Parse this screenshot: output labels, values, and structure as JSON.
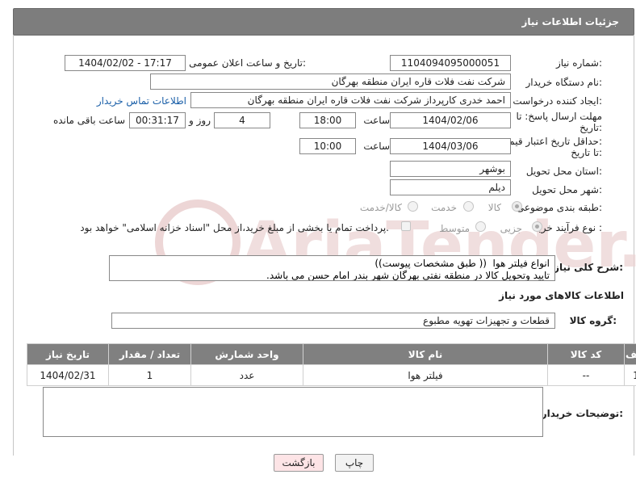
{
  "header": {
    "title": "جزئیات اطلاعات نیاز"
  },
  "form": {
    "need_number_label": "شماره نیاز:",
    "need_number": "1104094095000051",
    "announce_label": "تاریخ و ساعت اعلان عمومی:",
    "announce_value": "1404/02/02 - 17:17",
    "buyer_org_label": "نام دستگاه خریدار:",
    "buyer_org": "شرکت نفت فلات قاره ایران منطقه بهرگان",
    "requester_label": "ایجاد کننده درخواست:",
    "requester": "احمد خدری کارپرداز شرکت نفت فلات قاره ایران منطقه بهرگان",
    "contact_link": "اطلاعات تماس خریدار",
    "deadline_label_1": "مهلت ارسال پاسخ: تا",
    "deadline_label_2": "تاریخ:",
    "deadline_date": "1404/02/06",
    "time_label": "ساعت",
    "deadline_time": "18:00",
    "days_value": "4",
    "days_label": "روز و",
    "remaining_time": "00:31:17",
    "remaining_label": "ساعت باقی مانده",
    "validity_label_1": "حداقل تاریخ اعتبار قیمت:",
    "validity_label_2": "تا تاریخ:",
    "validity_date": "1404/03/06",
    "validity_time_label": "ساعت",
    "validity_time": "10:00",
    "province_label": "استان محل تحویل:",
    "province": "بوشهر",
    "city_label": "شهر محل تحویل:",
    "city": "دیلم",
    "category_label": "طبقه بندی موضوعی:",
    "category_options": [
      "کالا",
      "خدمت",
      "کالا/خدمت"
    ],
    "process_label": "نوع فرآیند خرید :",
    "process_options": [
      "جزیی",
      "متوسط"
    ],
    "process_note": "پرداخت تمام یا بخشی از مبلغ خرید،از محل \"اسناد خزانه اسلامی\" خواهد بود."
  },
  "description": {
    "label": "شرح کلی نیاز:",
    "text": "انواع فیلتر هوا  (( طبق مشخصات پیوست))\nتایید وتحویل کالا در منطقه نفتی بهرگان شهر بندر امام حسن می باشد."
  },
  "goods": {
    "section_title": "اطلاعات کالاهای مورد نیاز",
    "group_label": "گروه کالا:",
    "group_value": "قطعات و تجهیزات تهویه مطبوع"
  },
  "table": {
    "headers": [
      "ردیف",
      "کد کالا",
      "نام کالا",
      "واحد شمارش",
      "تعداد / مقدار",
      "تاریخ نیاز"
    ],
    "rows": [
      [
        "1",
        "--",
        "فیلتر هوا",
        "عدد",
        "1",
        "1404/02/31"
      ]
    ]
  },
  "buyer_notes": {
    "label": "توضیحات خریدار:",
    "text": ""
  },
  "buttons": {
    "print": "چاپ",
    "back": "بازگشت"
  },
  "watermark": {
    "text": "AriaTender.net"
  },
  "colors": {
    "header_bg": "#7d7d7d",
    "link": "#1a5fa8",
    "watermark": "#e6c9c9"
  }
}
